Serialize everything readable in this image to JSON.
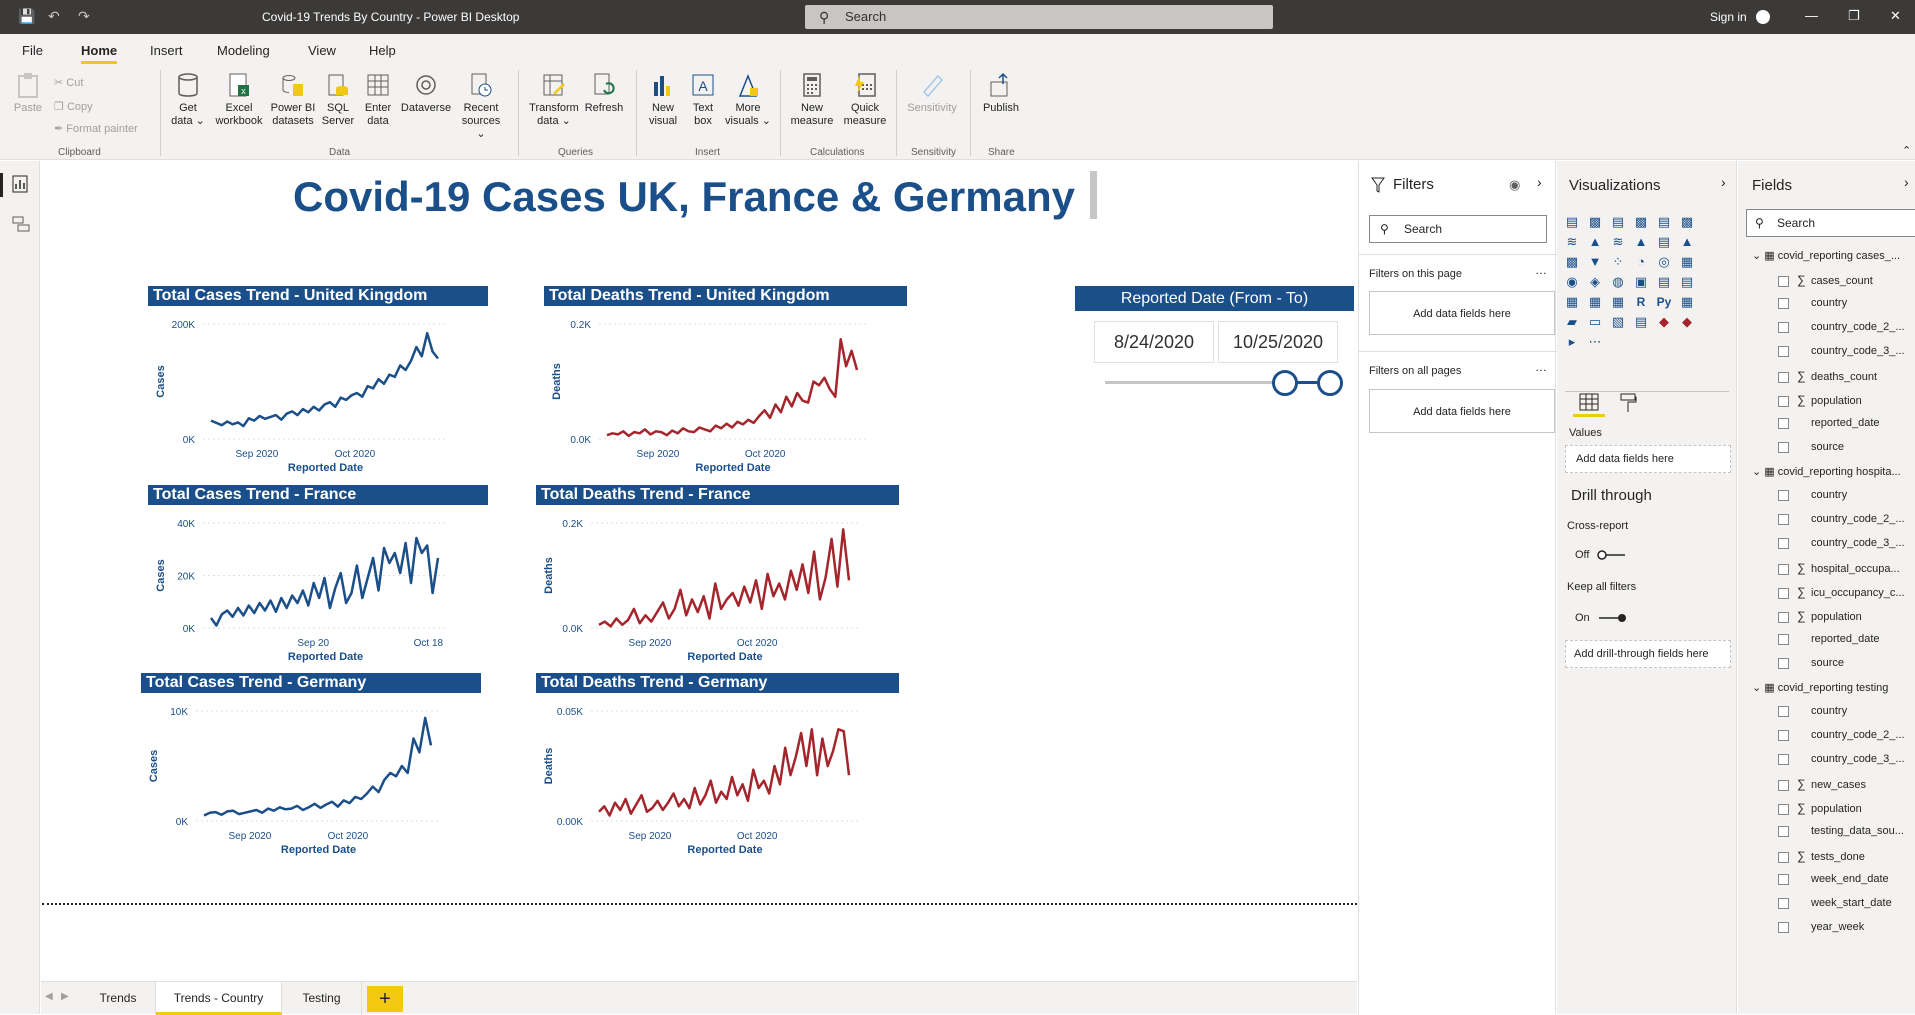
{
  "window": {
    "title": "Covid-19 Trends By Country - Power BI Desktop",
    "search_placeholder": "Search",
    "sign_in": "Sign in"
  },
  "menu": [
    "File",
    "Home",
    "Insert",
    "Modeling",
    "View",
    "Help"
  ],
  "menu_active": "Home",
  "ribbon": {
    "clipboard": {
      "paste": "Paste",
      "cut": "Cut",
      "copy": "Copy",
      "format_painter": "Format painter",
      "label": "Clipboard"
    },
    "data": {
      "get_data": "Get data ⌄",
      "excel": "Excel workbook",
      "pbi_datasets": "Power BI datasets",
      "sql": "SQL Server",
      "enter_data": "Enter data",
      "dataverse": "Dataverse",
      "recent_sources": "Recent sources ⌄",
      "label": "Data"
    },
    "queries": {
      "transform": "Transform data ⌄",
      "refresh": "Refresh",
      "label": "Queries"
    },
    "insert": {
      "new_visual": "New visual",
      "text_box": "Text box",
      "more_visuals": "More visuals ⌄",
      "label": "Insert"
    },
    "calculations": {
      "new_measure": "New measure",
      "quick_measure": "Quick measure",
      "label": "Calculations"
    },
    "sensitivity": {
      "btn": "Sensitivity",
      "label": "Sensitivity"
    },
    "share": {
      "publish": "Publish",
      "label": "Share"
    }
  },
  "report": {
    "title": "Covid-19 Cases UK, France & Germany",
    "slicer": {
      "title": "Reported Date (From - To)",
      "from": "8/24/2020",
      "to": "10/25/2020",
      "range_fraction": [
        0.8,
        1.0
      ]
    }
  },
  "charts": [
    {
      "title": "Total Cases Trend - United Kingdom",
      "ylabel": "Cases",
      "xlabel": "Reported Date",
      "color": "#1b4f8a",
      "yticks": [
        "200K",
        "0K"
      ],
      "xticks": [
        "Sep 2020",
        "Oct 2020"
      ],
      "ymax": 250000,
      "values": [
        40000,
        35000,
        30000,
        38000,
        32000,
        36000,
        28000,
        45000,
        40000,
        50000,
        44000,
        48000,
        52000,
        42000,
        55000,
        60000,
        52000,
        65000,
        58000,
        70000,
        62000,
        75000,
        80000,
        70000,
        90000,
        85000,
        95000,
        100000,
        92000,
        115000,
        110000,
        130000,
        120000,
        140000,
        135000,
        160000,
        150000,
        170000,
        200000,
        180000,
        230000,
        190000,
        175000
      ]
    },
    {
      "title": "Total Deaths Trend - United Kingdom",
      "ylabel": "Deaths",
      "xlabel": "Reported Date",
      "color": "#a4262c",
      "yticks": [
        "0.2K",
        "0.0K"
      ],
      "xticks": [
        "Sep 2020",
        "Oct 2020"
      ],
      "ymax": 300,
      "values": [
        10,
        15,
        12,
        20,
        8,
        18,
        15,
        25,
        12,
        20,
        18,
        10,
        22,
        15,
        28,
        20,
        18,
        30,
        25,
        20,
        35,
        28,
        40,
        30,
        45,
        38,
        50,
        42,
        60,
        75,
        55,
        90,
        70,
        110,
        85,
        120,
        100,
        95,
        150,
        140,
        160,
        130,
        110,
        260,
        190,
        230,
        180
      ]
    },
    {
      "title": "Total Cases Trend - France",
      "ylabel": "Cases",
      "xlabel": "Reported Date",
      "color": "#1b4f8a",
      "yticks": [
        "40K",
        "20K",
        "0K"
      ],
      "xticks": [
        "Sep 20",
        "Oct 18"
      ],
      "ymax": 42000,
      "values": [
        4000,
        1000,
        5500,
        7000,
        4500,
        8000,
        5000,
        9000,
        6000,
        10000,
        7000,
        11000,
        6500,
        12000,
        8000,
        13000,
        10000,
        15000,
        9000,
        18000,
        12000,
        20000,
        8000,
        16000,
        22000,
        10000,
        14000,
        25000,
        12000,
        20000,
        28000,
        15000,
        32000,
        26000,
        30000,
        22000,
        34000,
        18000,
        36000,
        30000,
        33000,
        14000,
        28000
      ]
    },
    {
      "title": "Total Deaths Trend - France",
      "ylabel": "Deaths",
      "xlabel": "Reported Date",
      "color": "#a4262c",
      "yticks": [
        "0.2K",
        "0.0K"
      ],
      "xticks": [
        "Sep 2020",
        "Oct 2020"
      ],
      "ymax": 330,
      "values": [
        10,
        20,
        5,
        30,
        10,
        25,
        60,
        15,
        40,
        20,
        50,
        80,
        30,
        60,
        120,
        40,
        90,
        50,
        100,
        30,
        140,
        60,
        90,
        110,
        70,
        130,
        80,
        150,
        60,
        170,
        100,
        140,
        90,
        180,
        120,
        200,
        110,
        240,
        90,
        160,
        280,
        130,
        310,
        150
      ]
    },
    {
      "title": "Total Cases Trend - Germany",
      "ylabel": "Cases",
      "xlabel": "Reported Date",
      "color": "#1b4f8a",
      "yticks": [
        "10K",
        "0K"
      ],
      "xticks": [
        "Sep 2020",
        "Oct 2020"
      ],
      "ymax": 16000,
      "values": [
        800,
        1200,
        1300,
        900,
        1400,
        1500,
        1000,
        1200,
        1400,
        1600,
        1200,
        1800,
        1500,
        2000,
        1700,
        1800,
        2200,
        1600,
        2000,
        2500,
        1900,
        2400,
        2800,
        2100,
        3000,
        2600,
        3500,
        3200,
        4000,
        5000,
        4200,
        6000,
        7000,
        6500,
        8000,
        7000,
        12000,
        10000,
        15000,
        11000
      ]
    },
    {
      "title": "Total Deaths Trend - Germany",
      "ylabel": "Deaths",
      "xlabel": "Reported Date",
      "color": "#a4262c",
      "yticks": [
        "0.05K",
        "0.00K"
      ],
      "xticks": [
        "Sep 2020",
        "Oct 2020"
      ],
      "ymax": 60,
      "values": [
        5,
        8,
        3,
        10,
        6,
        12,
        4,
        9,
        14,
        5,
        7,
        11,
        6,
        10,
        15,
        8,
        12,
        7,
        18,
        9,
        14,
        22,
        10,
        16,
        12,
        24,
        14,
        20,
        11,
        28,
        18,
        22,
        15,
        30,
        20,
        40,
        25,
        35,
        48,
        30,
        50,
        25,
        45,
        30,
        38,
        50,
        49,
        25
      ]
    }
  ],
  "tabs": [
    "Trends",
    "Trends - Country",
    "Testing"
  ],
  "tab_active": "Trends - Country",
  "filters_pane": {
    "title": "Filters",
    "search": "Search",
    "on_this_page": "Filters on this page",
    "on_all_pages": "Filters on all pages",
    "add_fields": "Add data fields here"
  },
  "viz_pane": {
    "title": "Visualizations",
    "values_label": "Values",
    "add_fields": "Add data fields here",
    "drill_through": "Drill through",
    "cross_report": "Cross-report",
    "cross_report_state": "Off",
    "keep_all_filters": "Keep all filters",
    "keep_state": "On",
    "add_drill": "Add drill-through fields here"
  },
  "fields_pane": {
    "title": "Fields",
    "search": "Search",
    "tables": [
      {
        "name": "covid_reporting cases_...",
        "fields": [
          {
            "name": "cases_count",
            "sum": true
          },
          {
            "name": "country",
            "sum": false
          },
          {
            "name": "country_code_2_...",
            "sum": false
          },
          {
            "name": "country_code_3_...",
            "sum": false
          },
          {
            "name": "deaths_count",
            "sum": true
          },
          {
            "name": "population",
            "sum": true
          },
          {
            "name": "reported_date",
            "sum": false
          },
          {
            "name": "source",
            "sum": false
          }
        ]
      },
      {
        "name": "covid_reporting hospita...",
        "fields": [
          {
            "name": "country",
            "sum": false
          },
          {
            "name": "country_code_2_...",
            "sum": false
          },
          {
            "name": "country_code_3_...",
            "sum": false
          },
          {
            "name": "hospital_occupa...",
            "sum": true
          },
          {
            "name": "icu_occupancy_c...",
            "sum": true
          },
          {
            "name": "population",
            "sum": true
          },
          {
            "name": "reported_date",
            "sum": false
          },
          {
            "name": "source",
            "sum": false
          }
        ]
      },
      {
        "name": "covid_reporting testing",
        "fields": [
          {
            "name": "country",
            "sum": false
          },
          {
            "name": "country_code_2_...",
            "sum": false
          },
          {
            "name": "country_code_3_...",
            "sum": false
          },
          {
            "name": "new_cases",
            "sum": true
          },
          {
            "name": "population",
            "sum": true
          },
          {
            "name": "testing_data_sou...",
            "sum": false
          },
          {
            "name": "tests_done",
            "sum": true
          },
          {
            "name": "week_end_date",
            "sum": false
          },
          {
            "name": "week_start_date",
            "sum": false
          },
          {
            "name": "year_week",
            "sum": false
          }
        ]
      }
    ]
  }
}
